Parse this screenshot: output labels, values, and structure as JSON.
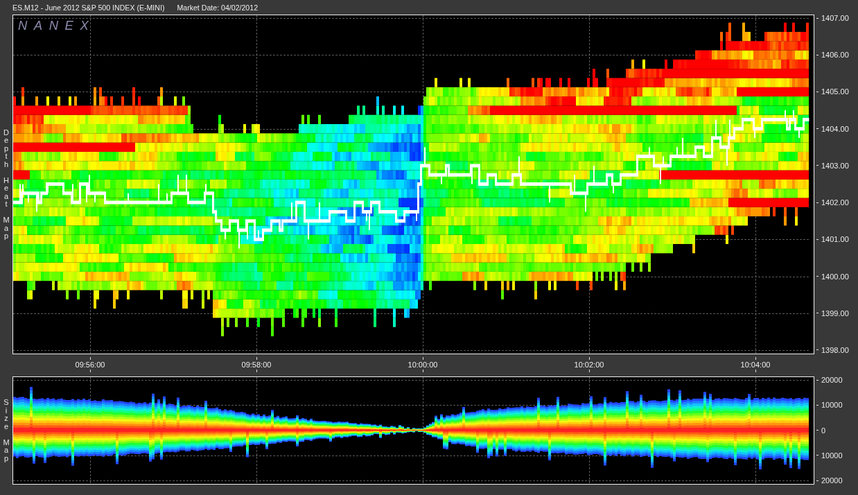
{
  "header": {
    "instrument": "ES.M12 - June 2012 S&P 500 INDEX (E-MINI)",
    "market_date": "Market Date: 04/02/2012"
  },
  "depth_heat_map": {
    "side_label": "Depth Heat Map",
    "logo": "NANEX",
    "y_ticks": [
      "1407.00",
      "1406.00",
      "1405.00",
      "1404.00",
      "1403.00",
      "1402.00",
      "1401.00",
      "1400.00",
      "1399.00",
      "1398.00"
    ]
  },
  "time_axis": {
    "ticks": [
      "09:56:00",
      "09:58:00",
      "10:00:00",
      "10:02:00",
      "10:04:00"
    ]
  },
  "size_map": {
    "side_label": "Size Map",
    "y_ticks": [
      "20000",
      "10000",
      "0",
      "10000",
      "20000"
    ]
  }
}
